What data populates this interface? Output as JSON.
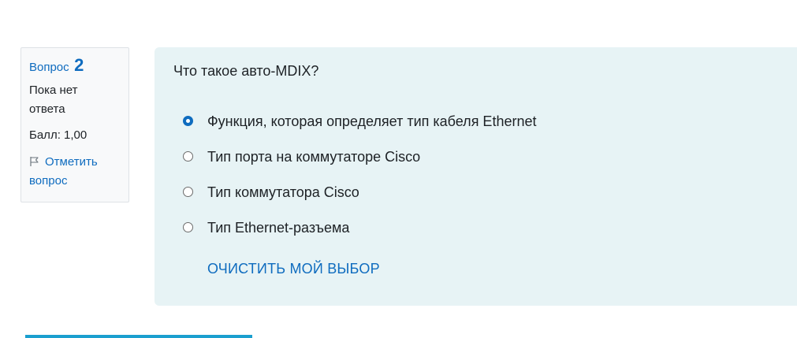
{
  "info": {
    "question_label": "Вопрос",
    "question_number": "2",
    "state": "Пока нет ответа",
    "grade": "Балл: 1,00",
    "flag_label": "Отметить вопрос"
  },
  "question": {
    "text": "Что такое авто-MDIX?",
    "answers": [
      {
        "label": "Функция, которая определяет тип кабеля Ethernet",
        "selected": true
      },
      {
        "label": "Тип порта на коммутаторе Cisco",
        "selected": false
      },
      {
        "label": "Тип коммутатора Cisco",
        "selected": false
      },
      {
        "label": "Тип Ethernet-разъема",
        "selected": false
      }
    ],
    "clear_label": "ОЧИСТИТЬ МОЙ ВЫБОР"
  },
  "colors": {
    "link": "#0f6cbf",
    "panel_bg": "#e7f3f5",
    "info_bg": "#f8f9fa",
    "bottom_bar": "#1a9fcf"
  },
  "icons": {
    "flag": "flag-icon",
    "radio_selected": "radio-checked",
    "radio_unselected": "radio-unchecked"
  }
}
